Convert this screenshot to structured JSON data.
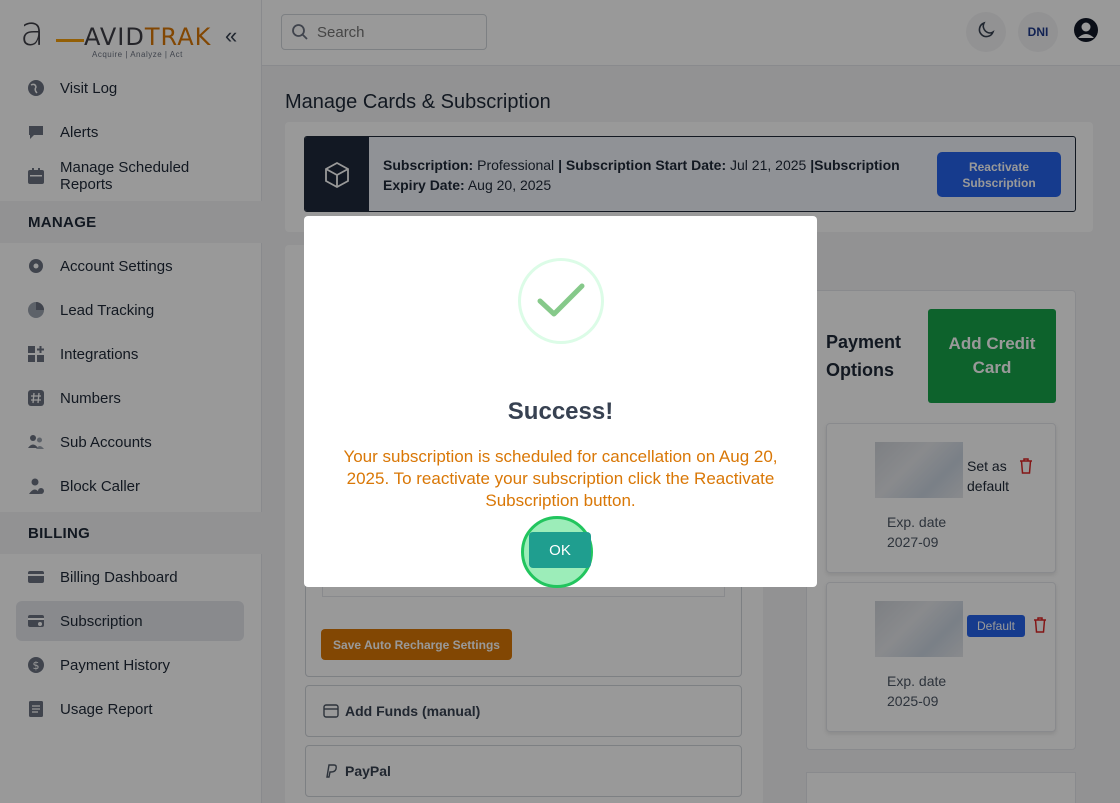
{
  "logo": {
    "mark": "a",
    "name_a": "AVID",
    "name_b": "TRAK",
    "tagline": "Acquire  |  Analyze  |  Act"
  },
  "sidebar": {
    "items": [
      {
        "label": "Visit Log"
      },
      {
        "label": "Alerts"
      },
      {
        "label": "Manage Scheduled Reports"
      }
    ],
    "manage_title": "MANAGE",
    "manage_items": [
      {
        "label": "Account Settings"
      },
      {
        "label": "Lead Tracking"
      },
      {
        "label": "Integrations"
      },
      {
        "label": "Numbers"
      },
      {
        "label": "Sub Accounts"
      },
      {
        "label": "Block Caller"
      }
    ],
    "billing_title": "BILLING",
    "billing_items": [
      {
        "label": "Billing Dashboard"
      },
      {
        "label": "Subscription"
      },
      {
        "label": "Payment History"
      },
      {
        "label": "Usage Report"
      }
    ]
  },
  "topbar": {
    "search_placeholder": "Search",
    "dni_label": "DNI"
  },
  "page": {
    "title": "Manage Cards & Subscription",
    "subscription": {
      "label_sub": "Subscription:",
      "plan": "Professional",
      "label_start": "| Subscription Start Date:",
      "start_date": "Jul 21, 2025",
      "label_sub2": "|Subscription",
      "label_expiry": "Expiry Date:",
      "expiry_date": "Aug 20, 2025",
      "reactivate_label": "Reactivate Subscription"
    },
    "payment_options_title": "Payment Options",
    "add_card_label": "Add Credit Card",
    "cards": [
      {
        "set_default_label": "Set as default",
        "exp_label": "Exp. date",
        "exp_value": "2027-09"
      },
      {
        "default_label": "Default",
        "exp_label": "Exp. date",
        "exp_value": "2025-09"
      }
    ],
    "save_auto_label": "Save Auto Recharge Settings",
    "add_funds_label": "Add Funds (manual)",
    "paypal_label": "PayPal"
  },
  "modal": {
    "title": "Success!",
    "message": "Your subscription is scheduled for cancellation on Aug 20, 2025. To reactivate your subscription click the Reactivate Subscription button.",
    "ok_label": "OK"
  },
  "colors": {
    "accent": "#d97706",
    "primary": "#2563eb",
    "success": "#16a34a",
    "ok": "#1f9e8f"
  }
}
